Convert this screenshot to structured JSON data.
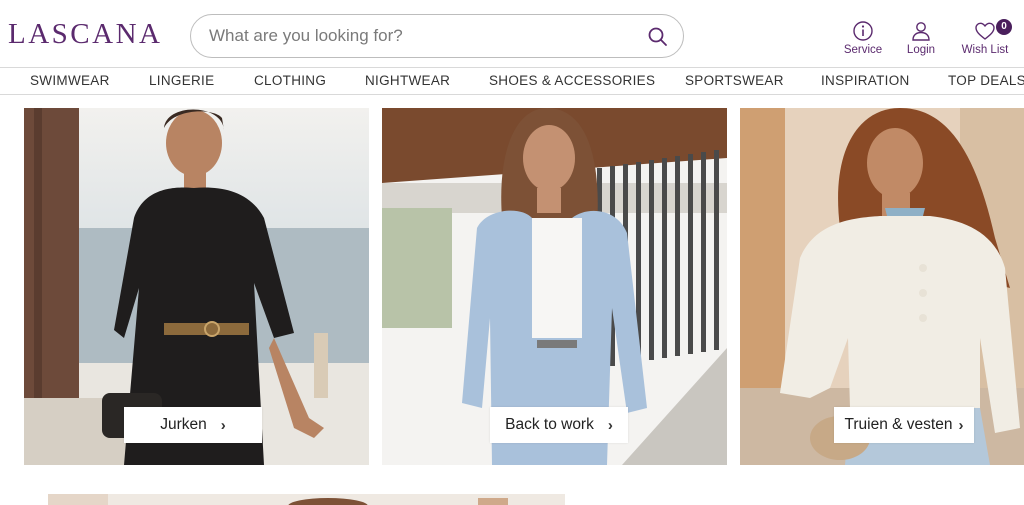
{
  "header": {
    "logo": "LASCANA",
    "search": {
      "placeholder": "What are you looking for?"
    },
    "utilities": {
      "service_label": "Service",
      "login_label": "Login",
      "wishlist_label": "Wish List",
      "wishlist_count": "0"
    }
  },
  "nav": {
    "items": [
      "SWIMWEAR",
      "LINGERIE",
      "CLOTHING",
      "NIGHTWEAR",
      "SHOES & ACCESSORIES",
      "SPORTSWEAR",
      "INSPIRATION",
      "TOP DEALS"
    ]
  },
  "tiles": [
    {
      "label": "Jurken",
      "chevron": "›"
    },
    {
      "label": "Back to work",
      "chevron": "›"
    },
    {
      "label": "Truien & vesten",
      "chevron": "›"
    }
  ],
  "colors": {
    "brand": "#5b2a6e",
    "badge": "#4a1f5c",
    "border": "#bdbdbd"
  }
}
